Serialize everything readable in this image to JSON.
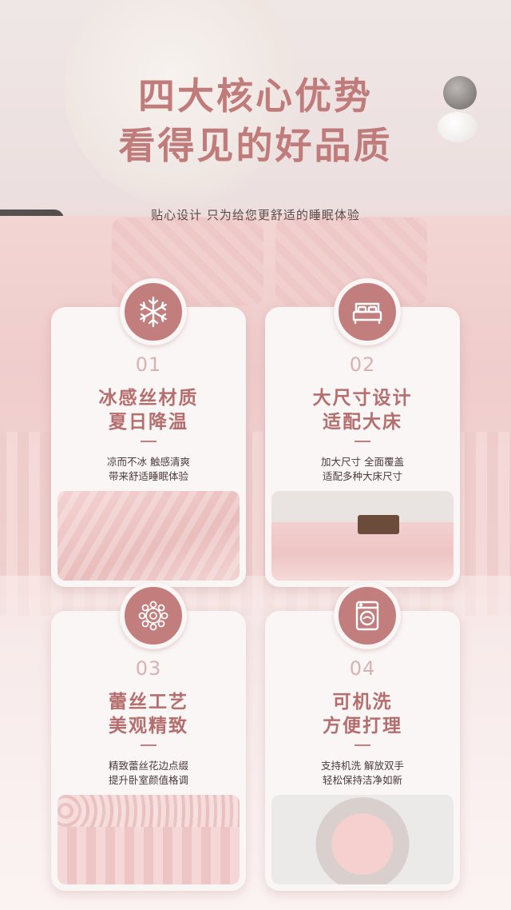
{
  "header": {
    "title_line1": "四大核心优势",
    "title_line2": "看得见的好品质",
    "subtitle": "贴心设计 只为给您更舒适的睡眠体验"
  },
  "colors": {
    "accent": "#c27d7d",
    "title": "#c07b7b",
    "number": "#d8b1b1",
    "card_bg": "#faf6f5"
  },
  "cards": [
    {
      "icon": "snowflake-icon",
      "number": "01",
      "title_line1": "冰感丝材质",
      "title_line2": "夏日降温",
      "desc_line1": "凉而不冰 触感清爽",
      "desc_line2": "带来舒适睡眠体验"
    },
    {
      "icon": "bed-icon",
      "number": "02",
      "title_line1": "大尺寸设计",
      "title_line2": "适配大床",
      "desc_line1": "加大尺寸 全面覆盖",
      "desc_line2": "适配多种大床尺寸"
    },
    {
      "icon": "lace-icon",
      "number": "03",
      "title_line1": "蕾丝工艺",
      "title_line2": "美观精致",
      "desc_line1": "精致蕾丝花边点缀",
      "desc_line2": "提升卧室颜值格调"
    },
    {
      "icon": "washing-machine-icon",
      "number": "04",
      "title_line1": "可机洗",
      "title_line2": "方便打理",
      "desc_line1": "支持机洗 解放双手",
      "desc_line2": "轻松保持洁净如新"
    }
  ]
}
